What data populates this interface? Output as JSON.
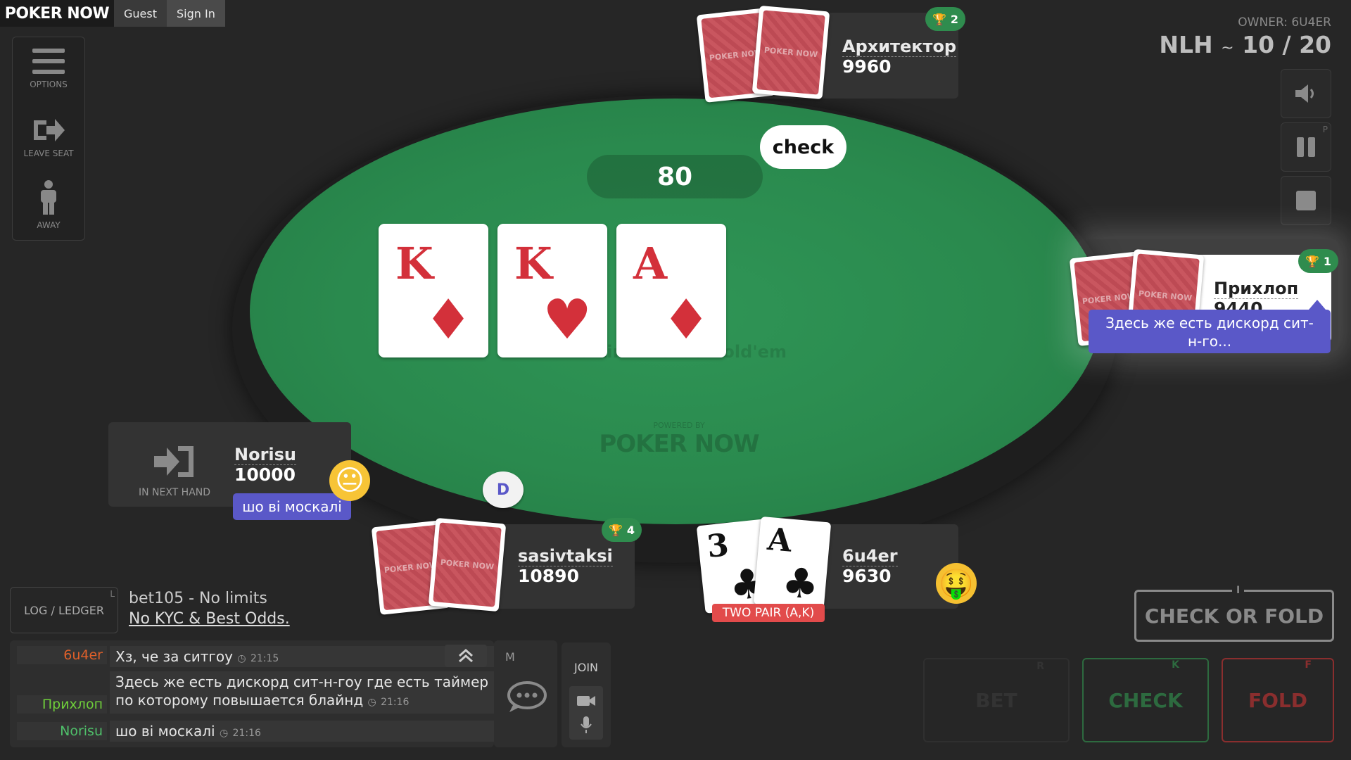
{
  "topbar": {
    "logo": "POKER NOW",
    "guest": "Guest",
    "signin": "Sign In"
  },
  "menu": {
    "options": "OPTIONS",
    "leave_seat": "LEAVE SEAT",
    "away": "AWAY"
  },
  "game": {
    "owner": "OWNER: 6U4ER",
    "type": "NLH",
    "sep": "~",
    "blinds": "10 / 20",
    "pause_key": "P"
  },
  "table": {
    "pot": "80",
    "watermark": "No Limit Texas Hold'em",
    "powered_by": "POWERED BY",
    "brand": "POKER NOW",
    "last_action": "check"
  },
  "board": [
    {
      "rank": "K",
      "suit": "♦"
    },
    {
      "rank": "K",
      "suit": "♥"
    },
    {
      "rank": "A",
      "suit": "♦"
    }
  ],
  "seats": {
    "top": {
      "name": "Архитектор",
      "stack": "9960",
      "trophies": "2"
    },
    "right": {
      "name": "Прихлоп",
      "stack": "9440",
      "trophies": "1",
      "chat_bubble": "Здесь же есть дискорд сит-н-го..."
    },
    "left": {
      "name": "Norisu",
      "stack": "10000",
      "status": "IN NEXT HAND",
      "chat_bubble": "шо ві москалі",
      "emoji": "😐"
    },
    "bottom_left": {
      "name": "sasivtaksi",
      "stack": "10890",
      "trophies": "4",
      "dealer": "D"
    },
    "hero": {
      "name": "6u4er",
      "stack": "9630",
      "hand_label": "TWO PAIR (A,K)",
      "emoji": "🤑",
      "cards": [
        {
          "rank": "3",
          "suit": "♣"
        },
        {
          "rank": "A",
          "suit": "♣"
        }
      ]
    }
  },
  "card_back_text": "POKER NOW",
  "log": {
    "button": "LOG / LEDGER",
    "key": "L"
  },
  "ad": {
    "line1": "bet105 - No limits",
    "line2": "No KYC & Best Odds."
  },
  "chat": {
    "messages": [
      {
        "name": "6u4er",
        "name_color": "#e0602a",
        "text": "Хз, че за ситгоу",
        "time": "21:15"
      },
      {
        "name": "Прихлоп",
        "name_color": "#6fcf3a",
        "text": "Здесь же есть дискорд сит-н-гоу где есть таймер по которому повышается блайнд",
        "time": "21:16"
      },
      {
        "name": "Norisu",
        "name_color": "#4fc06a",
        "text": "шо ві москалі",
        "time": "21:16"
      }
    ],
    "key": "M",
    "join": "JOIN"
  },
  "actions": {
    "check_or_fold": "CHECK OR FOLD",
    "check_or_fold_key": "I",
    "bet": "BET",
    "bet_key": "R",
    "check": "CHECK",
    "check_key": "K",
    "fold": "FOLD",
    "fold_key": "F"
  },
  "colors": {
    "felt": "#2a8a4e",
    "tooltip": "#5a58c8",
    "hand_badge": "#e24b4b",
    "check": "#3da35d",
    "fold": "#d84040"
  }
}
